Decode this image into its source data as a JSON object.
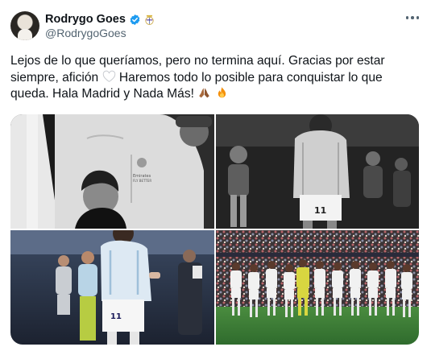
{
  "author": {
    "display_name": "Rodrygo Goes",
    "handle": "@RodrygoGoes"
  },
  "tweet": {
    "lines": [
      "Lejos de lo que queríamos, pero no termina aquí. Gracias por estar",
      "siempre, afición",
      "Haremos todo lo posible para conquistar lo que",
      "queda. Hala Madrid y Nada Más!"
    ],
    "emoji": [
      "white-heart-icon",
      "folded-hands-icon",
      "fire-icon"
    ]
  },
  "media": {
    "count": 4,
    "photos": [
      {
        "description": "black and white photo"
      },
      {
        "description": "black and white photo"
      },
      {
        "description": "color photo"
      },
      {
        "description": "color photo"
      }
    ],
    "jersey_text": [
      "Emirates FLY BETTER",
      "11"
    ]
  },
  "icons": {
    "verified": "verified-badge-icon",
    "club": "real-madrid-crest-icon",
    "more": "more-options-icon"
  },
  "colors": {
    "verified_blue": "#1d9bf0",
    "text_primary": "#0f1419",
    "text_secondary": "#536471",
    "pitch_green": "#3a7a3a",
    "keeper_kit": "#d8d640"
  }
}
